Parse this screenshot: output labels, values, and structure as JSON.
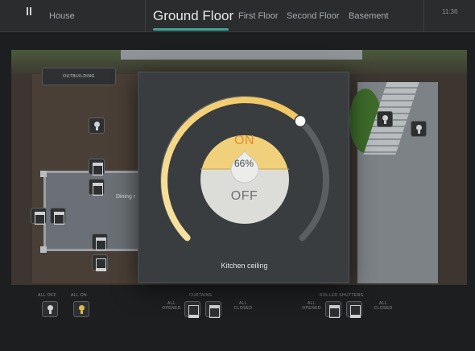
{
  "topbar": {
    "house": "House",
    "active_floor": "Ground Floor",
    "floors": [
      "First Floor",
      "Second Floor",
      "Basement"
    ],
    "clock": "11:36",
    "accent": "#3fa394"
  },
  "plan": {
    "outbuilding": "OUTBUILDING",
    "room_label": "Dining r"
  },
  "bottom": {
    "all_off": "ALL OFF",
    "all_on": "ALL ON",
    "curtains": "CURTAINS",
    "roller_shutters": "ROLLER SHUTTERS",
    "all_opened": "ALL OPENED",
    "all_closed": "ALL CLOSED"
  },
  "dimmer": {
    "on_label": "ON",
    "off_label": "OFF",
    "percent": 66,
    "percent_text": "66%",
    "device_name": "Kitchen ceiling",
    "on_color": "#f0d07a",
    "off_color": "#dcdcd8"
  }
}
